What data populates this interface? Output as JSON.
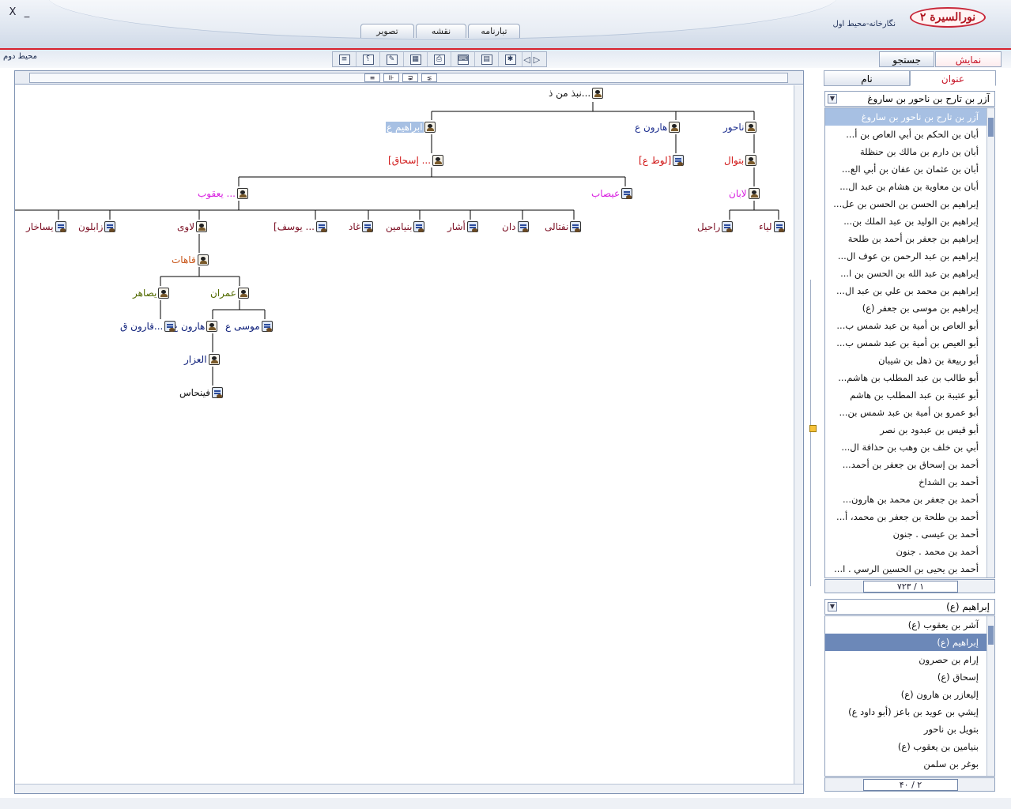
{
  "window": {
    "minimize_label": "_",
    "close_label": "X",
    "app_title": "نورالسیرة ۲",
    "app_subtitle": "نگارخانه-محیط اول"
  },
  "top_tabs": [
    {
      "label": "تبارنامه",
      "active": true
    },
    {
      "label": "نقشه",
      "active": false
    },
    {
      "label": "تصویر",
      "active": false
    }
  ],
  "toolbar": {
    "env2_label": "محیط دوم",
    "buttons": [
      "list-icon",
      "help-icon",
      "edit-icon",
      "grid-icon",
      "print-icon",
      "keyboard-icon",
      "book-icon",
      "settings-icon"
    ],
    "help_glyph": "؟"
  },
  "view_tabs": [
    {
      "label": "نمایش",
      "active": true
    },
    {
      "label": "جستجو",
      "active": false
    }
  ],
  "name_tabs": [
    {
      "label": "عنوان",
      "active": true
    },
    {
      "label": "نام",
      "active": false
    }
  ],
  "tree": {
    "root": "نبذ من ذ...",
    "level1": [
      "ناحور",
      "هارون ع",
      "ابراهيم ع"
    ],
    "level2": [
      "بتوال",
      "[لوط ع]",
      "[إسحاق ..."
    ],
    "level3": [
      "لابان",
      "عيصاب",
      "يعقوب ..."
    ],
    "level4": [
      "لياء",
      "راحيل",
      "نفتالى",
      "دان",
      "أشار",
      "بنيامين",
      "غاد",
      "[يوسف ...",
      "لاوى",
      "زابلون",
      "يساخار"
    ],
    "level5": [
      "قاهات"
    ],
    "level6": [
      "عمران",
      "يصاهر"
    ],
    "level7": [
      "موسى ع",
      "هارون ع",
      "قارون ق..."
    ],
    "level8": [
      "العزار"
    ],
    "level9": [
      "فينحاس"
    ]
  },
  "title_list": {
    "combo_value": "آزر بن تارح بن ناحور بن ساروغ",
    "items": [
      "آزر بن تارح بن ناحور بن ساروغ",
      "أبان بن الحكم بن أبي العاص بن أ...",
      "أبان بن دارم بن مالك بن حنظلة",
      "أبان بن عثمان بن عفان بن أبي الع...",
      "أبان بن معاوية بن هشام بن عبد ال...",
      "إبراهيم بن الحسن بن الحسن بن عل...",
      "إبراهيم بن الوليد بن عبد الملك بن...",
      "إبراهيم بن جعفر بن أحمد بن طلحة",
      "إبراهيم بن عبد الرحمن بن عوف ال...",
      "إبراهيم بن عبد الله بن الحسن بن ا...",
      "إبراهيم بن محمد بن علي بن عبد ال...",
      "إبراهيم بن موسى بن جعفر (ع)",
      "أبو العاص بن أمية بن عبد شمس ب...",
      "أبو العيص بن أمية بن عبد شمس ب...",
      "أبو ربيعة بن ذهل بن شيبان",
      "أبو طالب بن عبد المطلب بن هاشم...",
      "أبو عتيبة بن عبد المطلب بن هاشم",
      "أبو عمرو بن أمية بن عبد شمس بن...",
      "أبو قيس بن عبدود بن نصر",
      "أبي بن خلف بن وهب بن حذافة ال...",
      "أحمد بن إسحاق بن جعفر بن أحمد...",
      "أحمد بن الشداخ",
      "أحمد بن جعفر بن محمد بن هارون...",
      "أحمد بن طلحة بن جعفر بن محمد، أ...",
      "أحمد بن عيسى . جنون",
      "أحمد بن محمد . جنون",
      "أحمد بن يحيى بن الحسين الرسي . ا..."
    ],
    "page_current": "۱",
    "page_total": "۷۲۳"
  },
  "name_list": {
    "combo_value": "إبراهيم (ع)",
    "items": [
      "آشر بن يعقوب (ع)",
      "إبراهيم (ع)",
      "إرام بن حصرون",
      "إسحاق (ع)",
      "إليعازر بن هارون (ع)",
      "إيشي بن عويد بن باعز (أبو داود ع)",
      "بتويل بن ناحور",
      "بنيامين بن يعقوب (ع)",
      "بوغر بن سلمن"
    ],
    "page_current": "۲",
    "page_total": "۴۰"
  },
  "colors": {
    "accent_red": "#d8232f",
    "selection": "#a7c0e3",
    "tree_line": "#000000"
  }
}
